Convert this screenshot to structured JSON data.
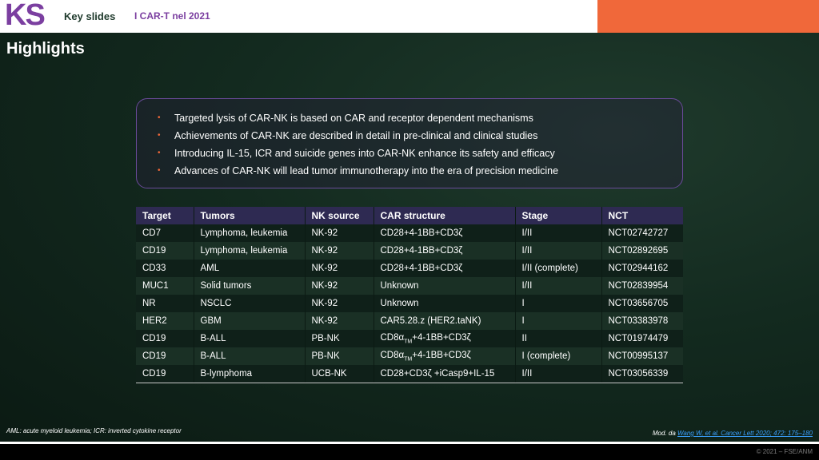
{
  "header": {
    "logo": "KS",
    "section": "Key slides",
    "deck_title": "I CAR-T nel 2021"
  },
  "title": "Highlights",
  "bullets": [
    "Targeted lysis of CAR-NK is based on CAR and receptor dependent mechanisms",
    "Achievements of CAR-NK are described in detail in pre-clinical and clinical studies",
    "Introducing IL-15, ICR and suicide genes into CAR-NK enhance its safety and efficacy",
    "Advances of CAR-NK will lead tumor immunotherapy into the era of precision medicine"
  ],
  "table": {
    "headers": [
      "Target",
      "Tumors",
      "NK source",
      "CAR structure",
      "Stage",
      "NCT"
    ],
    "rows": [
      {
        "target": "CD7",
        "tumors": "Lymphoma, leukemia",
        "source": "NK-92",
        "car": "CD28+4-1BB+CD3ζ",
        "stage": "I/II",
        "nct": "NCT02742727"
      },
      {
        "target": "CD19",
        "tumors": "Lymphoma, leukemia",
        "source": "NK-92",
        "car": "CD28+4-1BB+CD3ζ",
        "stage": "I/II",
        "nct": "NCT02892695"
      },
      {
        "target": "CD33",
        "tumors": "AML",
        "source": "NK-92",
        "car": "CD28+4-1BB+CD3ζ",
        "stage": "I/II (complete)",
        "nct": "NCT02944162"
      },
      {
        "target": "MUC1",
        "tumors": "Solid tumors",
        "source": "NK-92",
        "car": "Unknown",
        "stage": "I/II",
        "nct": "NCT02839954"
      },
      {
        "target": "NR",
        "tumors": "NSCLC",
        "source": "NK-92",
        "car": "Unknown",
        "stage": "I",
        "nct": "NCT03656705"
      },
      {
        "target": "HER2",
        "tumors": "GBM",
        "source": "NK-92",
        "car": "CAR5.28.z (HER2.taNK)",
        "stage": "I",
        "nct": "NCT03383978"
      },
      {
        "target": "CD19",
        "tumors": "B-ALL",
        "source": "PB-NK",
        "car_pre": "CD8α",
        "car_sub": "TM",
        "car_post": "+4-1BB+CD3ζ",
        "stage": "II",
        "nct": "NCT01974479"
      },
      {
        "target": "CD19",
        "tumors": "B-ALL",
        "source": "PB-NK",
        "car_pre": "CD8α",
        "car_sub": "TM",
        "car_post": "+4-1BB+CD3ζ",
        "stage": "I (complete)",
        "nct": "NCT00995137"
      },
      {
        "target": "CD19",
        "tumors": "B-lymphoma",
        "source": "UCB-NK",
        "car": "CD28+CD3ζ +iCasp9+IL-15",
        "stage": "I/II",
        "nct": "NCT03056339"
      }
    ]
  },
  "footnotes": {
    "left": "AML: acute myeloid leukemia; ICR: inverted cytokine receptor",
    "right_prefix": "Mod. da ",
    "right_link": "Wang W, et al. Cancer Lett 2020; 472: 175–180"
  },
  "copyright": "© 2021 – FSE/ANM",
  "colors": {
    "accent_orange": "#f0683a",
    "brand_purple": "#7b3fa0",
    "header_row": "#2e2a52"
  }
}
